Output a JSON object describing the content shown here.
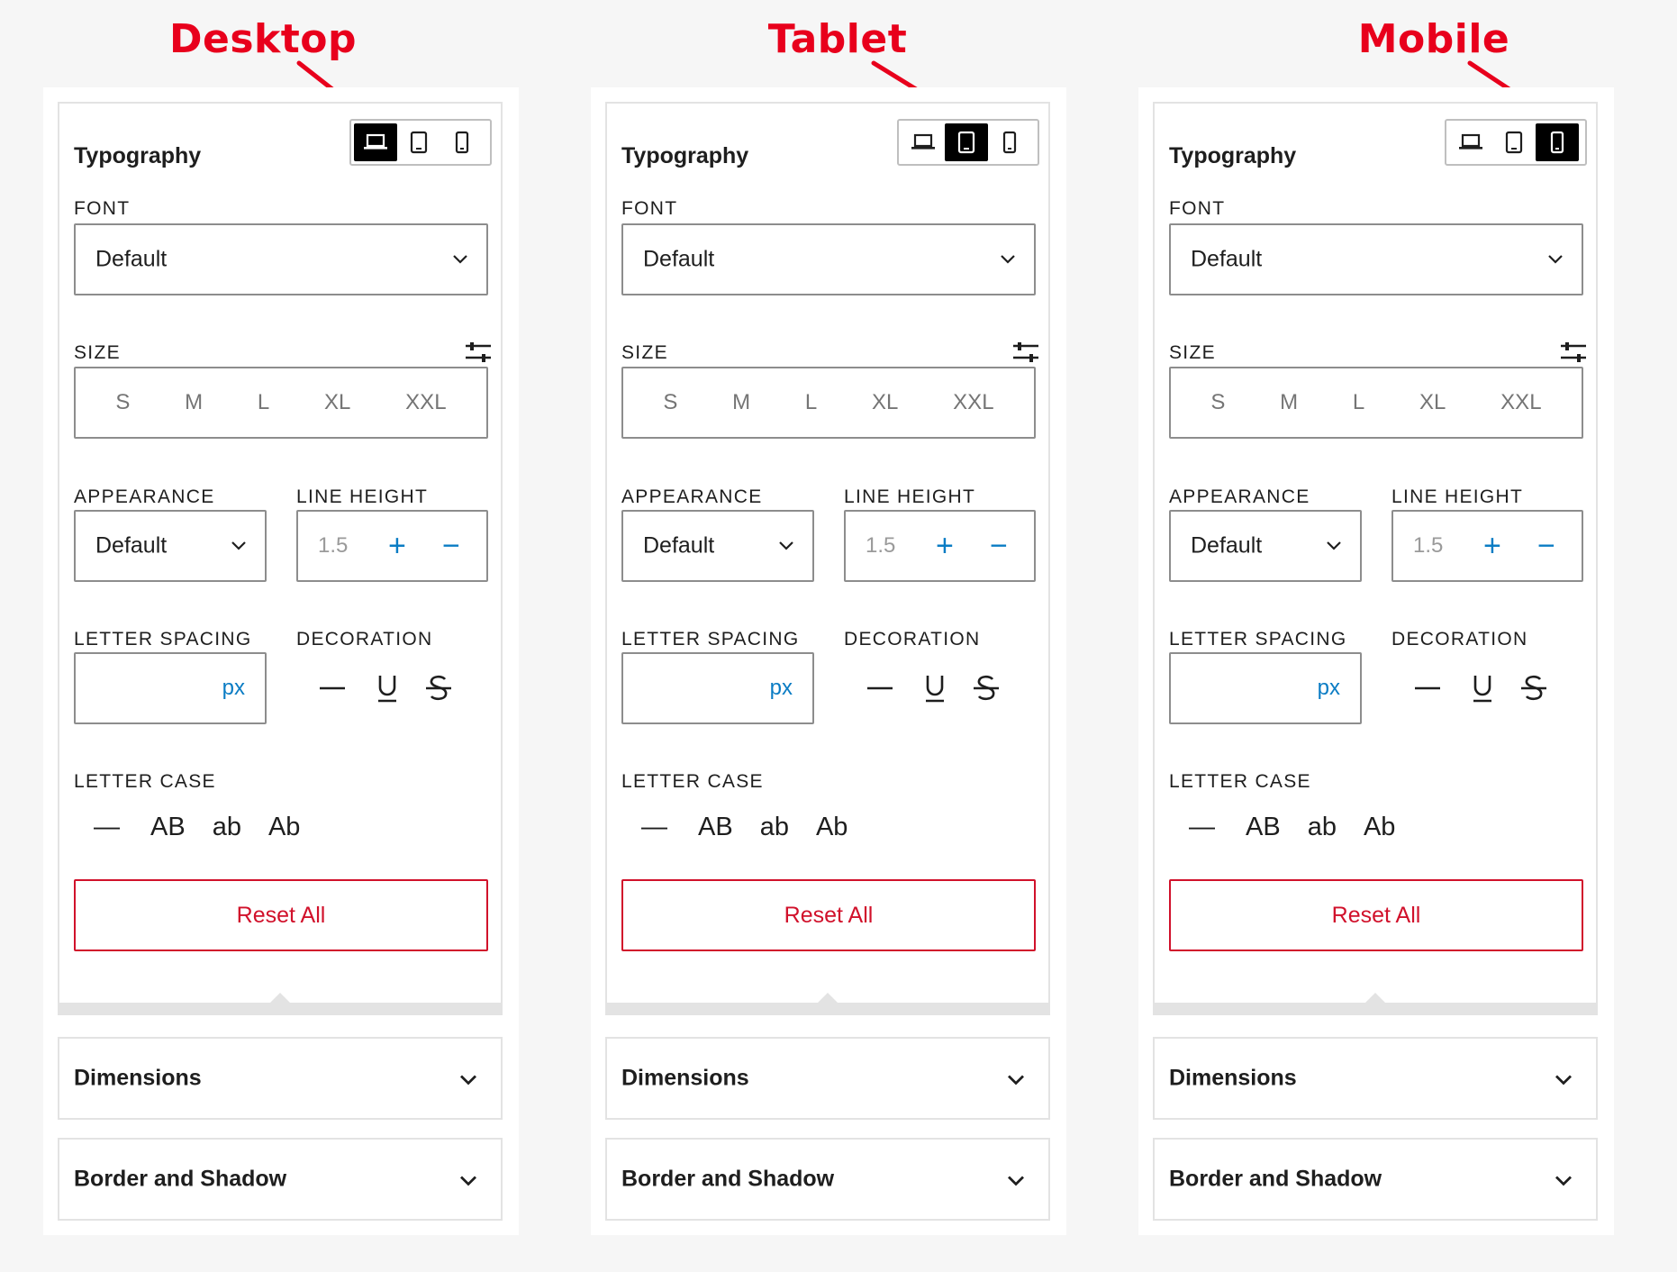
{
  "columns": [
    {
      "callout": "Desktop",
      "active_device": "desktop",
      "panel": {
        "title": "Typography",
        "devices": [
          {
            "name": "desktop",
            "icon": "laptop-icon"
          },
          {
            "name": "tablet",
            "icon": "tablet-icon"
          },
          {
            "name": "mobile",
            "icon": "phone-icon"
          }
        ],
        "font": {
          "label": "FONT",
          "value": "Default"
        },
        "size": {
          "label": "SIZE",
          "options": [
            "S",
            "M",
            "L",
            "XL",
            "XXL"
          ]
        },
        "appearance": {
          "label": "APPEARANCE",
          "value": "Default"
        },
        "line_height": {
          "label": "LINE HEIGHT",
          "value": "1.5",
          "plus": "+",
          "minus": "−"
        },
        "letter_spacing": {
          "label": "LETTER SPACING",
          "value": "",
          "unit": "px"
        },
        "decoration": {
          "label": "DECORATION"
        },
        "letter_case": {
          "label": "LETTER CASE",
          "options": [
            "—",
            "AB",
            "ab",
            "Ab"
          ]
        },
        "reset_label": "Reset All"
      },
      "accordions": [
        "Dimensions",
        "Border and Shadow"
      ]
    },
    {
      "callout": "Tablet",
      "active_device": "tablet",
      "panel": {
        "title": "Typography",
        "devices": [
          {
            "name": "desktop",
            "icon": "laptop-icon"
          },
          {
            "name": "tablet",
            "icon": "tablet-icon"
          },
          {
            "name": "mobile",
            "icon": "phone-icon"
          }
        ],
        "font": {
          "label": "FONT",
          "value": "Default"
        },
        "size": {
          "label": "SIZE",
          "options": [
            "S",
            "M",
            "L",
            "XL",
            "XXL"
          ]
        },
        "appearance": {
          "label": "APPEARANCE",
          "value": "Default"
        },
        "line_height": {
          "label": "LINE HEIGHT",
          "value": "1.5",
          "plus": "+",
          "minus": "−"
        },
        "letter_spacing": {
          "label": "LETTER SPACING",
          "value": "",
          "unit": "px"
        },
        "decoration": {
          "label": "DECORATION"
        },
        "letter_case": {
          "label": "LETTER CASE",
          "options": [
            "—",
            "AB",
            "ab",
            "Ab"
          ]
        },
        "reset_label": "Reset All"
      },
      "accordions": [
        "Dimensions",
        "Border and Shadow"
      ]
    },
    {
      "callout": "Mobile",
      "active_device": "mobile",
      "panel": {
        "title": "Typography",
        "devices": [
          {
            "name": "desktop",
            "icon": "laptop-icon"
          },
          {
            "name": "tablet",
            "icon": "tablet-icon"
          },
          {
            "name": "mobile",
            "icon": "phone-icon"
          }
        ],
        "font": {
          "label": "FONT",
          "value": "Default"
        },
        "size": {
          "label": "SIZE",
          "options": [
            "S",
            "M",
            "L",
            "XL",
            "XXL"
          ]
        },
        "appearance": {
          "label": "APPEARANCE",
          "value": "Default"
        },
        "line_height": {
          "label": "LINE HEIGHT",
          "value": "1.5",
          "plus": "+",
          "minus": "−"
        },
        "letter_spacing": {
          "label": "LETTER SPACING",
          "value": "",
          "unit": "px"
        },
        "decoration": {
          "label": "DECORATION"
        },
        "letter_case": {
          "label": "LETTER CASE",
          "options": [
            "—",
            "AB",
            "ab",
            "Ab"
          ]
        },
        "reset_label": "Reset All"
      },
      "accordions": [
        "Dimensions",
        "Border and Shadow"
      ]
    }
  ],
  "colors": {
    "callout": "#e8001c",
    "accent": "#0a7cc4",
    "reset": "#d1112b",
    "active_device_bg": "#000000"
  }
}
